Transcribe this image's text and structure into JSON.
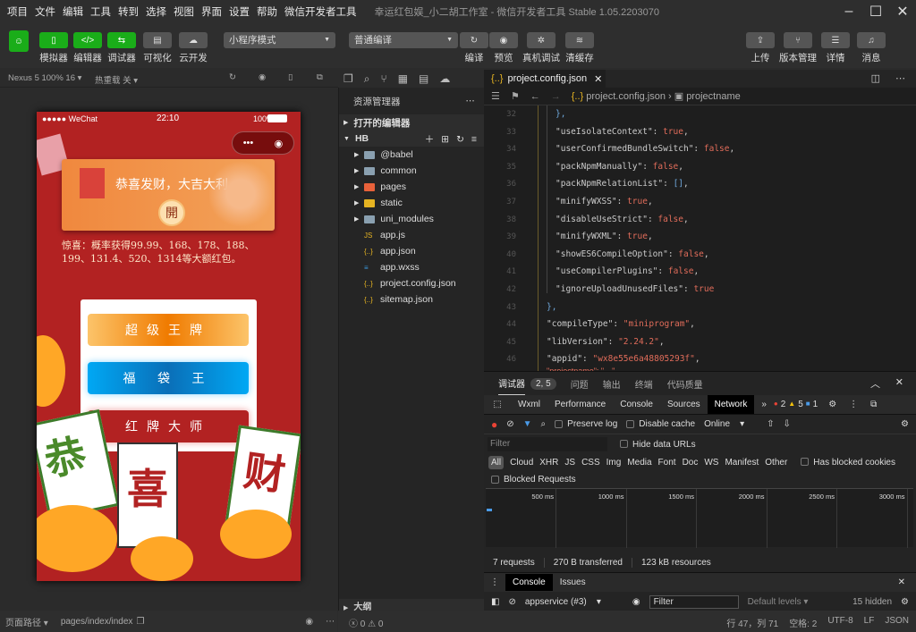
{
  "menu": [
    "项目",
    "文件",
    "编辑",
    "工具",
    "转到",
    "选择",
    "视图",
    "界面",
    "设置",
    "帮助",
    "微信开发者工具"
  ],
  "window_title": "幸运红包娱_小二胡工作室 - 微信开发者工具 Stable 1.05.2203070",
  "toolbar": {
    "left": [
      "模拟器",
      "编辑器",
      "调试器",
      "可视化",
      "云开发"
    ],
    "mode": "小程序模式",
    "compile": "普通编译",
    "mid": [
      "编译",
      "预览",
      "真机调试",
      "清缓存"
    ],
    "right": [
      "上传",
      "版本管理",
      "详情",
      "消息"
    ]
  },
  "simbar": {
    "device": "Nexus 5 100% 16 ▾",
    "hotreload": "热重载 关 ▾"
  },
  "phone": {
    "carrier": "●●●●● WeChat",
    "time": "22:10",
    "battery": "100%",
    "banner": "恭喜发财，大吉大利",
    "open": "開",
    "notice": "惊喜：概率获得99.99、168、178、188、199、131.4、520、1314等大额红包。",
    "buttons": [
      "超级王牌",
      "福 袋 王",
      "红牌大师"
    ],
    "tiles": [
      "恭",
      "喜",
      "财"
    ]
  },
  "simfoot": {
    "path_label": "页面路径 ▾",
    "path": "pages/index/index"
  },
  "explorer": {
    "title": "资源管理器",
    "open_editors": "打开的编辑器",
    "root": "HB",
    "folders": [
      "@babel",
      "common",
      "pages",
      "static",
      "uni_modules"
    ],
    "files": [
      "app.js",
      "app.json",
      "app.wxss",
      "project.config.json",
      "sitemap.json"
    ],
    "outline": "大纲",
    "errors": "0",
    "warnings": "0"
  },
  "editor": {
    "tab": "project.config.json",
    "breadcrumb_file": "project.config.json",
    "breadcrumb_node": "projectname",
    "lines": [
      {
        "n": "32",
        "i": 1,
        "t": [
          [
            "p",
            "},"
          ]
        ]
      },
      {
        "n": "33",
        "i": 1,
        "t": [
          [
            "k",
            "\"useIsolateContext\": "
          ],
          [
            "b",
            "true"
          ],
          [
            "k",
            ","
          ]
        ]
      },
      {
        "n": "34",
        "i": 1,
        "t": [
          [
            "k",
            "\"userConfirmedBundleSwitch\": "
          ],
          [
            "b",
            "false"
          ],
          [
            "k",
            ","
          ]
        ]
      },
      {
        "n": "35",
        "i": 1,
        "t": [
          [
            "k",
            "\"packNpmManually\": "
          ],
          [
            "b",
            "false"
          ],
          [
            "k",
            ","
          ]
        ]
      },
      {
        "n": "36",
        "i": 1,
        "t": [
          [
            "k",
            "\"packNpmRelationList\": "
          ],
          [
            "p",
            "[]"
          ],
          [
            "k",
            ","
          ]
        ]
      },
      {
        "n": "37",
        "i": 1,
        "t": [
          [
            "k",
            "\"minifyWXSS\": "
          ],
          [
            "b",
            "true"
          ],
          [
            "k",
            ","
          ]
        ]
      },
      {
        "n": "38",
        "i": 1,
        "t": [
          [
            "k",
            "\"disableUseStrict\": "
          ],
          [
            "b",
            "false"
          ],
          [
            "k",
            ","
          ]
        ]
      },
      {
        "n": "39",
        "i": 1,
        "t": [
          [
            "k",
            "\"minifyWXML\": "
          ],
          [
            "b",
            "true"
          ],
          [
            "k",
            ","
          ]
        ]
      },
      {
        "n": "40",
        "i": 1,
        "t": [
          [
            "k",
            "\"showES6CompileOption\": "
          ],
          [
            "b",
            "false"
          ],
          [
            "k",
            ","
          ]
        ]
      },
      {
        "n": "41",
        "i": 1,
        "t": [
          [
            "k",
            "\"useCompilerPlugins\": "
          ],
          [
            "b",
            "false"
          ],
          [
            "k",
            ","
          ]
        ]
      },
      {
        "n": "42",
        "i": 1,
        "t": [
          [
            "k",
            "\"ignoreUploadUnusedFiles\": "
          ],
          [
            "b",
            "true"
          ]
        ]
      },
      {
        "n": "43",
        "i": 0,
        "t": [
          [
            "p",
            "},"
          ]
        ]
      },
      {
        "n": "44",
        "i": 0,
        "t": [
          [
            "k",
            "\"compileType\": "
          ],
          [
            "s",
            "\"miniprogram\""
          ],
          [
            "k",
            ","
          ]
        ]
      },
      {
        "n": "45",
        "i": 0,
        "t": [
          [
            "k",
            "\"libVersion\": "
          ],
          [
            "s",
            "\"2.24.2\""
          ],
          [
            "k",
            ","
          ]
        ]
      },
      {
        "n": "46",
        "i": 0,
        "t": [
          [
            "k",
            "\"appid\": "
          ],
          [
            "s",
            "\"wx8e55e6a48805293f\""
          ],
          [
            "k",
            ","
          ]
        ]
      }
    ]
  },
  "devtools": {
    "tabs": [
      "调试器",
      "问题",
      "输出",
      "终端",
      "代码质量"
    ],
    "badge": "2, 5",
    "panels": [
      "Wxml",
      "Performance",
      "Console",
      "Sources",
      "Network"
    ],
    "active_panel": "Network",
    "errors": "2",
    "warnings": "5",
    "info": "1",
    "preserve_log": "Preserve log",
    "disable_cache": "Disable cache",
    "throttle": "Online",
    "filter_placeholder": "Filter",
    "hide_data_urls": "Hide data URLs",
    "types": [
      "All",
      "Cloud",
      "XHR",
      "JS",
      "CSS",
      "Img",
      "Media",
      "Font",
      "Doc",
      "WS",
      "Manifest",
      "Other"
    ],
    "has_blocked": "Has blocked cookies",
    "blocked_requests": "Blocked Requests",
    "ticks": [
      "500 ms",
      "1000 ms",
      "1500 ms",
      "2000 ms",
      "2500 ms",
      "3000 ms"
    ],
    "summary": [
      "7 requests",
      "270 B transferred",
      "123 kB resources"
    ],
    "drawer_tabs": [
      "Console",
      "Issues"
    ],
    "context": "appservice (#3)",
    "console_filter": "Filter",
    "levels": "Default levels ▾",
    "hidden": "15 hidden"
  },
  "status": {
    "pos": "行 47，列 71",
    "spaces": "空格: 2",
    "enc": "UTF-8",
    "eol": "LF",
    "lang": "JSON"
  },
  "colors": {
    "accent_green": "#1aad19",
    "phone_red": "#b22222",
    "network_active": "#000000"
  }
}
